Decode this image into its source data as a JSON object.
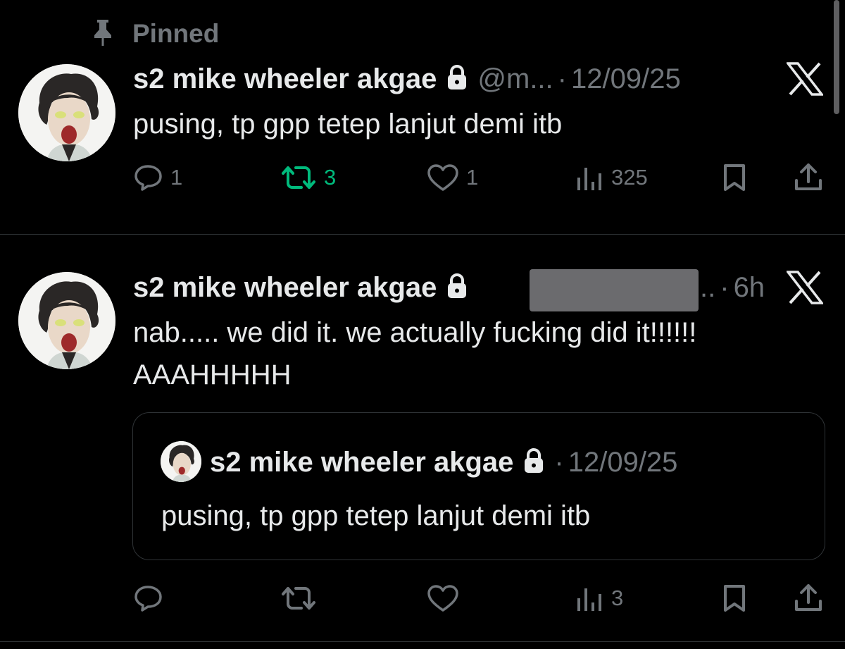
{
  "pinned_label": "Pinned",
  "tweets": [
    {
      "author": "s2 mike wheeler akgae",
      "handle": "@m...",
      "separator": "·",
      "time": "12/09/25",
      "text": "pusing, tp gpp tetep lanjut demi itb",
      "stats": {
        "replies": "1",
        "reposts": "3",
        "likes": "1",
        "views": "325"
      }
    },
    {
      "author": "s2 mike wheeler akgae",
      "handle_tail": "..",
      "separator": "·",
      "time": "6h",
      "text_line1": "nab..... we did it. we actually fucking did it!!!!!!",
      "text_line2": "AAAHHHHH",
      "quote": {
        "author": "s2 mike wheeler akgae",
        "separator": "·",
        "time": "12/09/25",
        "text": "pusing, tp gpp tetep lanjut demi itb"
      },
      "stats": {
        "views": "3"
      }
    }
  ],
  "colors": {
    "background": "#000000",
    "text": "#e7e9ea",
    "muted": "#71767b",
    "repost_active": "#00ba7c",
    "divider": "#2f3336"
  },
  "icons": [
    "pin-icon",
    "lock-icon",
    "x-logo-icon",
    "reply-icon",
    "repost-icon",
    "like-icon",
    "views-icon",
    "bookmark-icon",
    "share-icon"
  ]
}
